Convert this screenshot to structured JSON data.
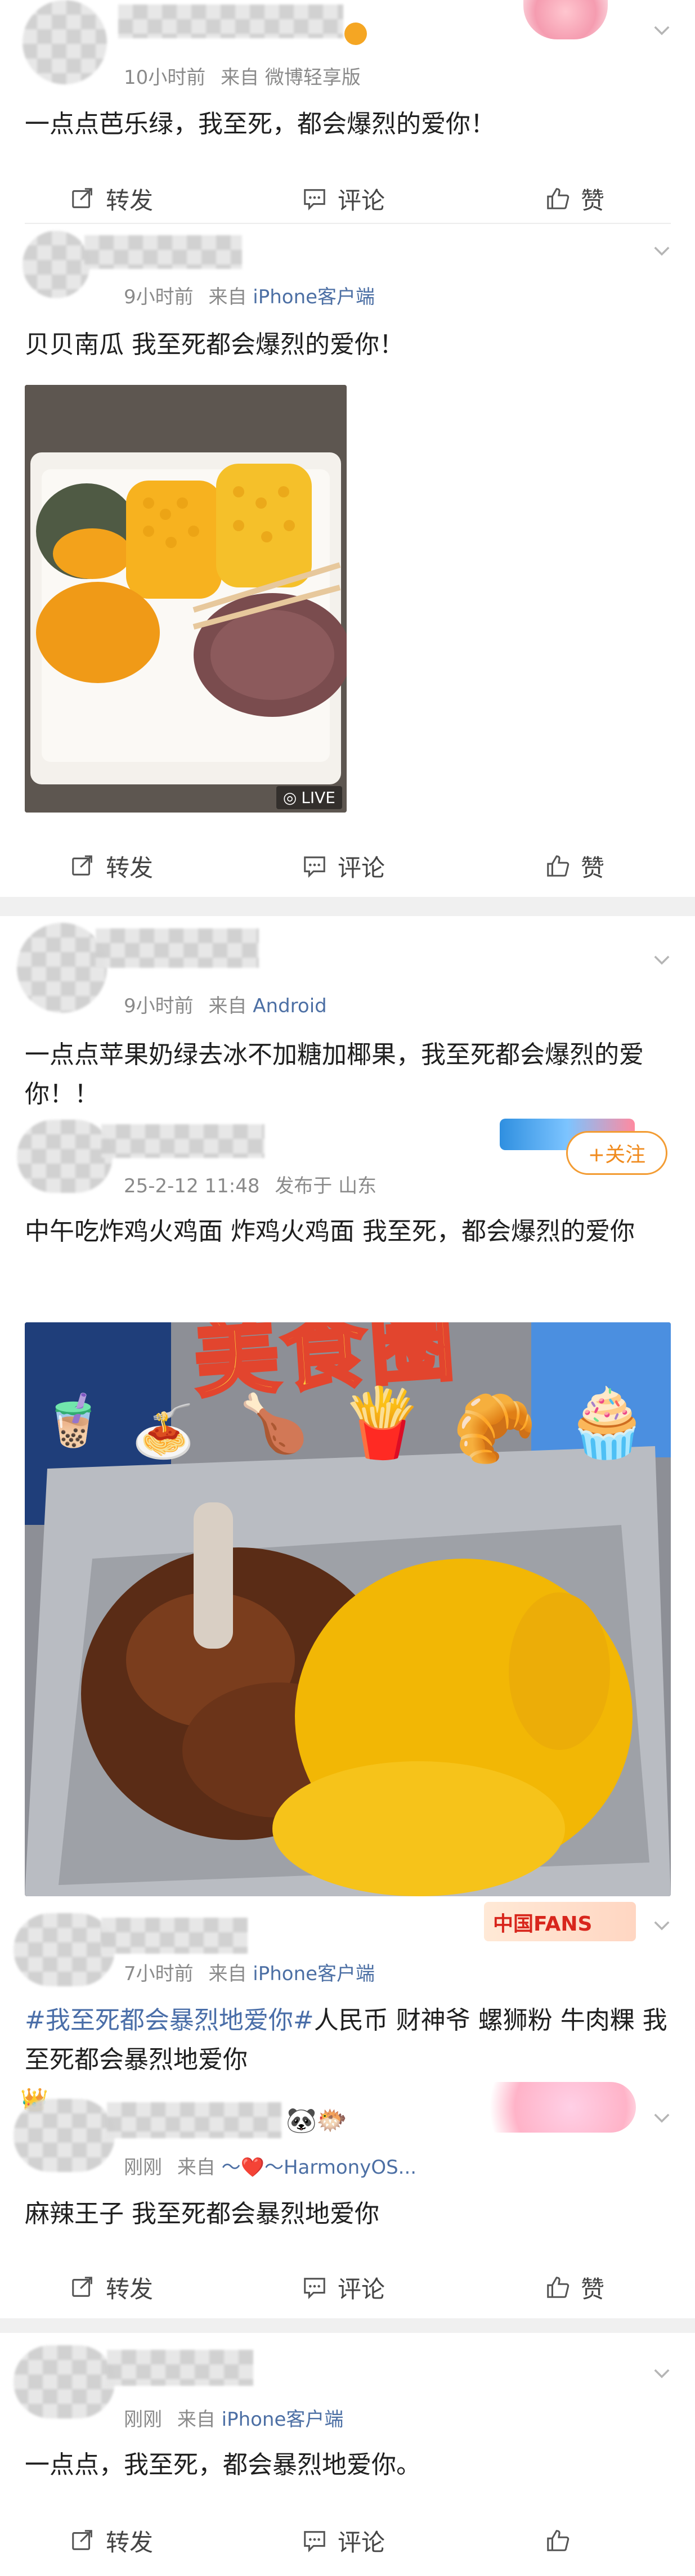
{
  "colors": {
    "meta_gray": "#8a8a8a",
    "source_blue": "#4c6fa4",
    "follow_orange": "#f08a1c",
    "divider": "#f0f0f0"
  },
  "posts": [
    {
      "time": "10小时前",
      "source_prefix": "来自",
      "source": "微博轻享版",
      "text": "一点点芭乐绿，我至死，都会爆烈的爱你！",
      "actions": {
        "repost": "转发",
        "comment": "评论",
        "like": "赞"
      }
    },
    {
      "time": "9小时前",
      "source_prefix": "来自",
      "source": "iPhone客户端",
      "text": "贝贝南瓜 我至死都会爆烈的爱你！",
      "image_badge": "LIVE",
      "actions": {
        "repost": "转发",
        "comment": "评论",
        "like": "赞"
      }
    },
    {
      "time": "9小时前",
      "source_prefix": "来自",
      "source": "Android",
      "text": "一点点苹果奶绿去冰不加糖加椰果，我至死都会爆烈的爱你！！"
    },
    {
      "time": "25-2-12 11:48",
      "source_prefix": "发布于",
      "source": "山东",
      "follow_label": "+关注",
      "text": "中午吃炸鸡火鸡面 炸鸡火鸡面 我至死，都会爆烈的爱你",
      "sticker_title": "美食圈"
    },
    {
      "time": "7小时前",
      "source_prefix": "来自",
      "source": "iPhone客户端",
      "hashtag": "#我至死都会暴烈地爱你#",
      "text": "人民币 财神爷 螺狮粉 牛肉粿 我至死都会暴烈地爱你",
      "badge_text": "中国FANS"
    },
    {
      "time": "刚刚",
      "source_prefix": "来自",
      "source": "～❤️～HarmonyOS...",
      "text": "麻辣王子 我至死都会暴烈地爱你",
      "actions": {
        "repost": "转发",
        "comment": "评论",
        "like": "赞"
      }
    },
    {
      "time": "刚刚",
      "source_prefix": "来自",
      "source": "iPhone客户端",
      "text": "一点点，我至死，都会暴烈地爱你。",
      "actions": {
        "repost": "转发",
        "comment": "评论"
      }
    }
  ]
}
